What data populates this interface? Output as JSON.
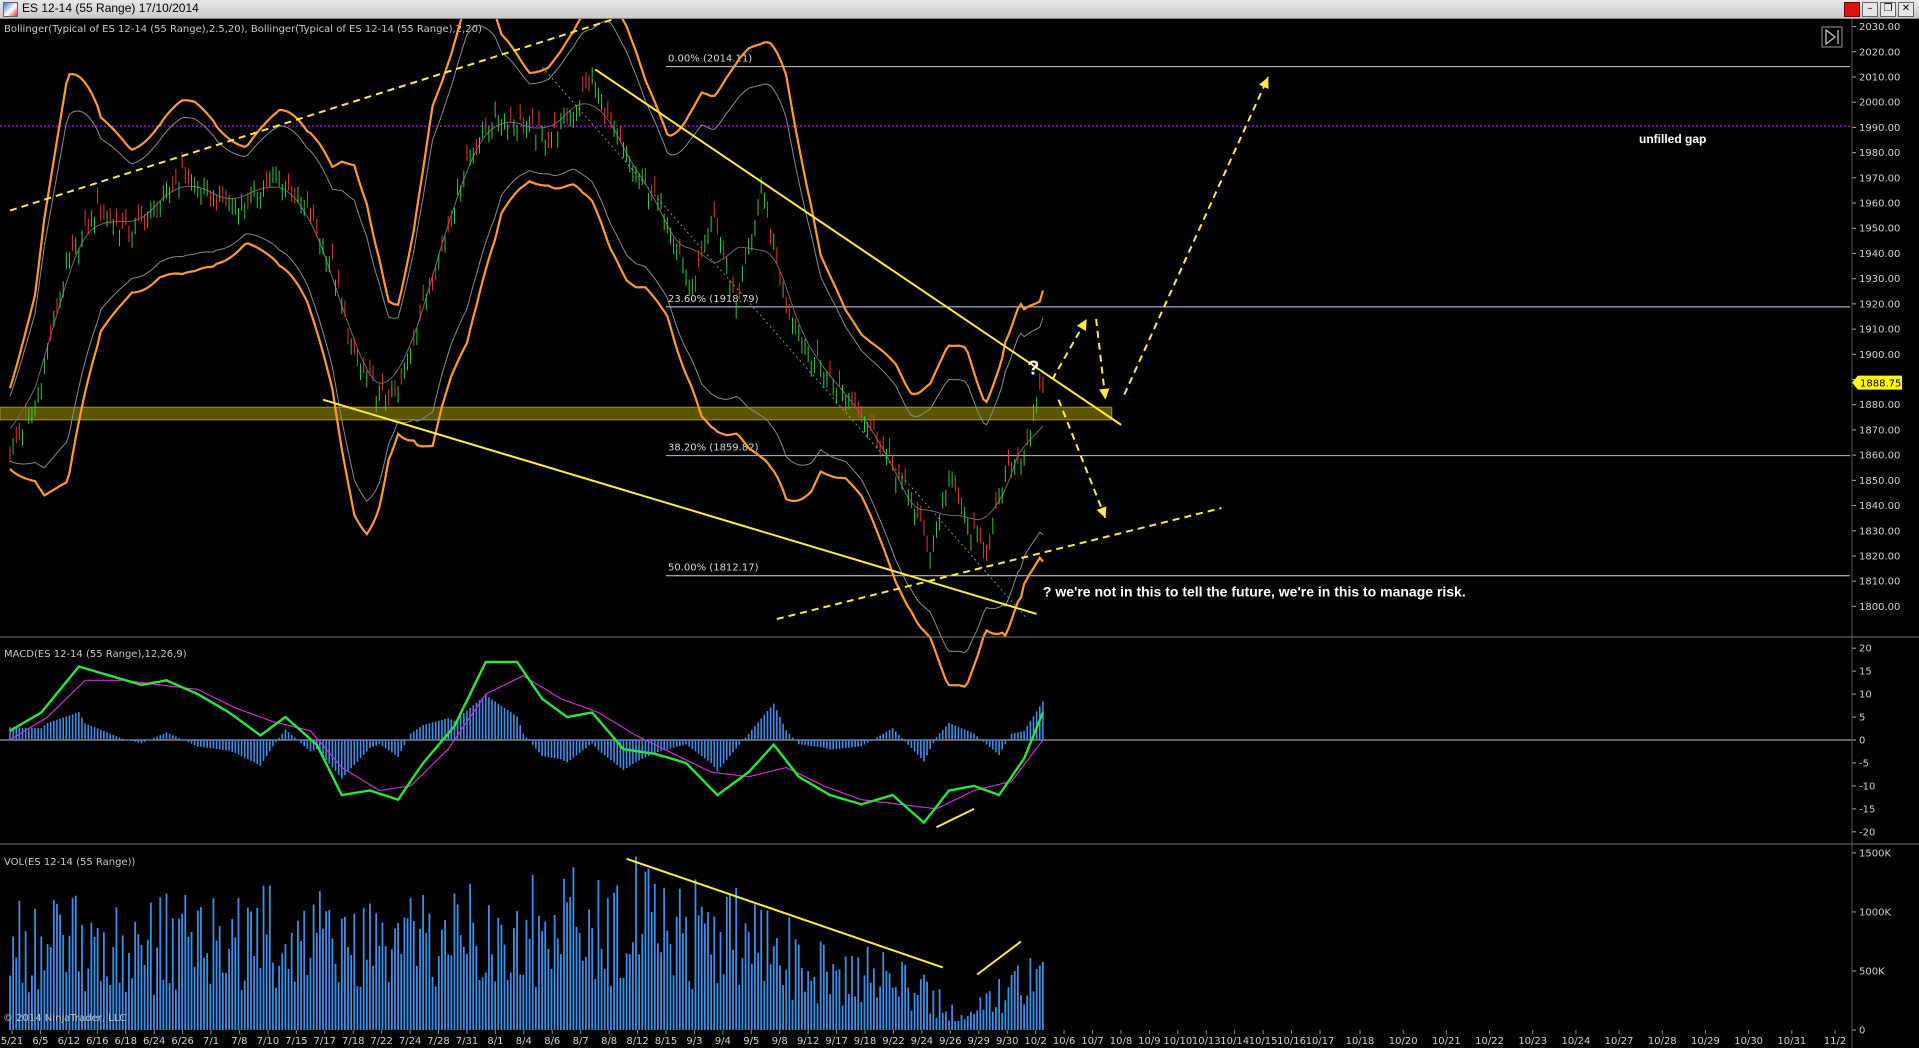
{
  "window": {
    "title": "ES 12-14 (55 Range)  17/10/2014",
    "close_glyph": "✕",
    "restore_glyph": "❐",
    "minimize_glyph": "–",
    "red_glyph": ""
  },
  "colors": {
    "background": "#000000",
    "bollinger_outer": "#ff9a2e",
    "bollinger_inner": "#8a8a8a",
    "candle_up": "#2ecc40",
    "candle_down": "#e8382e",
    "trendline": "#ffeb3b",
    "gap_line": "#a020f0",
    "zone": "#6b6400",
    "macd_line": "#27e83a",
    "signal_line": "#d02bd6",
    "histogram": "#3b8eea",
    "volume": "#3b8eea",
    "fib": "#a8d8ff",
    "price_marker": "#ffff00"
  },
  "chart_data": [
    {
      "type": "line",
      "panel": "price",
      "indicator_label": "Bollinger(Typical of ES 12-14 (55 Range),2.5,20), Bollinger(Typical of ES 12-14 (55 Range),2,20)",
      "y_ticks": [
        "1800.00",
        "1810.00",
        "1820.00",
        "1830.00",
        "1840.00",
        "1850.00",
        "1860.00",
        "1870.00",
        "1880.00",
        "1890.00",
        "1900.00",
        "1910.00",
        "1920.00",
        "1930.00",
        "1940.00",
        "1950.00",
        "1960.00",
        "1970.00",
        "1980.00",
        "1990.00",
        "2000.00",
        "2010.00",
        "2020.00",
        "2030.00"
      ],
      "y_tick_values": [
        1800,
        1810,
        1820,
        1830,
        1840,
        1850,
        1860,
        1870,
        1880,
        1890,
        1900,
        1910,
        1920,
        1930,
        1940,
        1950,
        1960,
        1970,
        1980,
        1990,
        2000,
        2010,
        2020,
        2030
      ],
      "ylim": [
        1795,
        2033
      ],
      "last_price": {
        "value": 1888.75,
        "label": "1888.75"
      },
      "fib_levels": [
        {
          "label": "0.00% (2014.11)",
          "value": 2014.11
        },
        {
          "label": "23.60% (1918.79)",
          "value": 1918.79
        },
        {
          "label": "38.20% (1859.82)",
          "value": 1859.82
        },
        {
          "label": "50.00% (1812.17)",
          "value": 1812.17
        }
      ],
      "unfilled_gap": {
        "label": "unfilled gap",
        "value": 1990.5
      },
      "support_zone": {
        "low": 1874,
        "high": 1879
      },
      "annotations": [
        {
          "text": "?",
          "bar": 325,
          "value": 1892
        },
        {
          "text": "?  we're not in this to tell the future, we're in this to manage risk.",
          "bar": 330,
          "value": 1804
        }
      ],
      "close_series": [
        {
          "bar": 0,
          "value": 1861
        },
        {
          "bar": 8,
          "value": 1880
        },
        {
          "bar": 18,
          "value": 1935
        },
        {
          "bar": 28,
          "value": 1958
        },
        {
          "bar": 38,
          "value": 1948
        },
        {
          "bar": 48,
          "value": 1960
        },
        {
          "bar": 55,
          "value": 1972
        },
        {
          "bar": 65,
          "value": 1962
        },
        {
          "bar": 75,
          "value": 1960
        },
        {
          "bar": 85,
          "value": 1972
        },
        {
          "bar": 95,
          "value": 1957
        },
        {
          "bar": 103,
          "value": 1936
        },
        {
          "bar": 110,
          "value": 1898
        },
        {
          "bar": 118,
          "value": 1884
        },
        {
          "bar": 124,
          "value": 1884
        },
        {
          "bar": 130,
          "value": 1912
        },
        {
          "bar": 138,
          "value": 1942
        },
        {
          "bar": 146,
          "value": 1978
        },
        {
          "bar": 155,
          "value": 1995
        },
        {
          "bar": 163,
          "value": 1992
        },
        {
          "bar": 172,
          "value": 1986
        },
        {
          "bar": 180,
          "value": 1997
        },
        {
          "bar": 186,
          "value": 2010
        },
        {
          "bar": 192,
          "value": 1990
        },
        {
          "bar": 200,
          "value": 1972
        },
        {
          "bar": 210,
          "value": 1956
        },
        {
          "bar": 218,
          "value": 1925
        },
        {
          "bar": 225,
          "value": 1955
        },
        {
          "bar": 232,
          "value": 1920
        },
        {
          "bar": 240,
          "value": 1965
        },
        {
          "bar": 248,
          "value": 1920
        },
        {
          "bar": 256,
          "value": 1900
        },
        {
          "bar": 264,
          "value": 1888
        },
        {
          "bar": 272,
          "value": 1878
        },
        {
          "bar": 280,
          "value": 1860
        },
        {
          "bar": 288,
          "value": 1842
        },
        {
          "bar": 294,
          "value": 1822
        },
        {
          "bar": 300,
          "value": 1852
        },
        {
          "bar": 306,
          "value": 1832
        },
        {
          "bar": 312,
          "value": 1822
        },
        {
          "bar": 318,
          "value": 1852
        },
        {
          "bar": 324,
          "value": 1862
        },
        {
          "bar": 330,
          "value": 1888
        }
      ],
      "trendlines": [
        {
          "style": "dashed",
          "from": {
            "bar": 0,
            "value": 1957
          },
          "to": {
            "bar": 193,
            "value": 2033
          }
        },
        {
          "style": "solid",
          "from": {
            "bar": 100,
            "value": 1882
          },
          "to": {
            "bar": 328,
            "value": 1797
          }
        },
        {
          "style": "solid",
          "from": {
            "bar": 187,
            "value": 2013
          },
          "to": {
            "bar": 355,
            "value": 1872
          }
        },
        {
          "style": "dashed",
          "from": {
            "bar": 245,
            "value": 1795
          },
          "to": {
            "bar": 387,
            "value": 1839
          }
        },
        {
          "style": "dashed-arrow",
          "from": {
            "bar": 333,
            "value": 1890
          },
          "to": {
            "bar": 344,
            "value": 1914
          }
        },
        {
          "style": "dashed-arrow",
          "from": {
            "bar": 347,
            "value": 1914
          },
          "to": {
            "bar": 350,
            "value": 1882
          }
        },
        {
          "style": "dashed-arrow",
          "from": {
            "bar": 356,
            "value": 1884
          },
          "to": {
            "bar": 402,
            "value": 2010
          }
        },
        {
          "style": "dashed-arrow",
          "from": {
            "bar": 335,
            "value": 1882
          },
          "to": {
            "bar": 350,
            "value": 1835
          }
        }
      ],
      "x_tick_labels": [
        "5/21",
        "6/5",
        "6/12",
        "6/16",
        "6/18",
        "6/24",
        "6/26",
        "7/1",
        "7/8",
        "7/10",
        "7/15",
        "7/17",
        "7/18",
        "7/22",
        "7/24",
        "7/28",
        "7/31",
        "8/1",
        "8/4",
        "8/6",
        "8/7",
        "8/8",
        "8/12",
        "8/15",
        "9/3",
        "9/4",
        "9/5",
        "9/8",
        "9/12",
        "9/17",
        "9/18",
        "9/22",
        "9/24",
        "9/26",
        "9/29",
        "9/30",
        "10/2",
        "10/6",
        "10/7",
        "10/8",
        "10/9",
        "10/10",
        "10/13",
        "10/14",
        "10/15",
        "10/16",
        "10/17",
        "10/18",
        "10/20",
        "10/21",
        "10/22",
        "10/23",
        "10/24",
        "10/27",
        "10/28",
        "10/29",
        "10/30",
        "10/31",
        "11/2"
      ]
    },
    {
      "type": "line",
      "panel": "macd",
      "indicator_label": "MACD(ES 12-14 (55 Range),12,26,9)",
      "y_ticks": [
        "-20",
        "-15",
        "-10",
        "-5",
        "0",
        "5",
        "10",
        "15",
        "20"
      ],
      "y_tick_values": [
        -20,
        -15,
        -10,
        -5,
        0,
        5,
        10,
        15,
        20
      ],
      "ylim": [
        -22,
        22
      ],
      "series": [
        {
          "role": "macd",
          "points": [
            {
              "bar": 0,
              "value": 2
            },
            {
              "bar": 10,
              "value": 6
            },
            {
              "bar": 22,
              "value": 16
            },
            {
              "bar": 32,
              "value": 14
            },
            {
              "bar": 42,
              "value": 12
            },
            {
              "bar": 50,
              "value": 13
            },
            {
              "bar": 60,
              "value": 10
            },
            {
              "bar": 70,
              "value": 6
            },
            {
              "bar": 80,
              "value": 1
            },
            {
              "bar": 88,
              "value": 5
            },
            {
              "bar": 98,
              "value": -1
            },
            {
              "bar": 106,
              "value": -12
            },
            {
              "bar": 115,
              "value": -11
            },
            {
              "bar": 124,
              "value": -13
            },
            {
              "bar": 132,
              "value": -5
            },
            {
              "bar": 142,
              "value": 3
            },
            {
              "bar": 152,
              "value": 17
            },
            {
              "bar": 162,
              "value": 17
            },
            {
              "bar": 170,
              "value": 9
            },
            {
              "bar": 178,
              "value": 5
            },
            {
              "bar": 186,
              "value": 6
            },
            {
              "bar": 196,
              "value": -2
            },
            {
              "bar": 206,
              "value": -3
            },
            {
              "bar": 216,
              "value": -5
            },
            {
              "bar": 226,
              "value": -12
            },
            {
              "bar": 236,
              "value": -7
            },
            {
              "bar": 244,
              "value": -1
            },
            {
              "bar": 252,
              "value": -8
            },
            {
              "bar": 262,
              "value": -12
            },
            {
              "bar": 272,
              "value": -14
            },
            {
              "bar": 282,
              "value": -12
            },
            {
              "bar": 292,
              "value": -18
            },
            {
              "bar": 300,
              "value": -11
            },
            {
              "bar": 308,
              "value": -10
            },
            {
              "bar": 316,
              "value": -12
            },
            {
              "bar": 324,
              "value": -4
            },
            {
              "bar": 330,
              "value": 6
            }
          ]
        },
        {
          "role": "signal",
          "points": [
            {
              "bar": 0,
              "value": 0
            },
            {
              "bar": 12,
              "value": 5
            },
            {
              "bar": 24,
              "value": 13
            },
            {
              "bar": 36,
              "value": 13
            },
            {
              "bar": 48,
              "value": 12
            },
            {
              "bar": 60,
              "value": 11
            },
            {
              "bar": 72,
              "value": 7
            },
            {
              "bar": 84,
              "value": 4
            },
            {
              "bar": 96,
              "value": 2
            },
            {
              "bar": 106,
              "value": -6
            },
            {
              "bar": 118,
              "value": -11
            },
            {
              "bar": 128,
              "value": -10
            },
            {
              "bar": 140,
              "value": -2
            },
            {
              "bar": 152,
              "value": 10
            },
            {
              "bar": 164,
              "value": 14
            },
            {
              "bar": 176,
              "value": 9
            },
            {
              "bar": 188,
              "value": 6
            },
            {
              "bar": 200,
              "value": 1
            },
            {
              "bar": 212,
              "value": -3
            },
            {
              "bar": 224,
              "value": -7
            },
            {
              "bar": 236,
              "value": -8
            },
            {
              "bar": 248,
              "value": -6
            },
            {
              "bar": 260,
              "value": -10
            },
            {
              "bar": 272,
              "value": -13
            },
            {
              "bar": 284,
              "value": -14
            },
            {
              "bar": 296,
              "value": -15
            },
            {
              "bar": 308,
              "value": -11
            },
            {
              "bar": 320,
              "value": -9
            },
            {
              "bar": 330,
              "value": 0
            }
          ]
        }
      ],
      "trendlines": [
        {
          "style": "solid",
          "from": {
            "bar": 296,
            "value": -19
          },
          "to": {
            "bar": 308,
            "value": -15
          }
        }
      ]
    },
    {
      "type": "bar",
      "panel": "volume",
      "indicator_label": "VOL(ES 12-14 (55 Range))",
      "y_ticks": [
        "0",
        "500K",
        "1000K",
        "1500K"
      ],
      "y_tick_values": [
        0,
        500000,
        1000000,
        1500000
      ],
      "ylim": [
        0,
        1550000
      ],
      "profile": [
        {
          "bar": 0,
          "value": 850000
        },
        {
          "bar": 40,
          "value": 820000
        },
        {
          "bar": 80,
          "value": 900000
        },
        {
          "bar": 120,
          "value": 780000
        },
        {
          "bar": 150,
          "value": 900000
        },
        {
          "bar": 180,
          "value": 1000000
        },
        {
          "bar": 200,
          "value": 1050000
        },
        {
          "bar": 230,
          "value": 880000
        },
        {
          "bar": 260,
          "value": 600000
        },
        {
          "bar": 285,
          "value": 470000
        },
        {
          "bar": 298,
          "value": 250000
        },
        {
          "bar": 305,
          "value": 100000
        },
        {
          "bar": 315,
          "value": 380000
        },
        {
          "bar": 330,
          "value": 600000
        }
      ],
      "trendlines": [
        {
          "style": "solid",
          "from": {
            "bar": 197,
            "value": 1450000
          },
          "to": {
            "bar": 298,
            "value": 530000
          }
        },
        {
          "style": "solid",
          "from": {
            "bar": 309,
            "value": 470000
          },
          "to": {
            "bar": 323,
            "value": 750000
          }
        }
      ]
    }
  ],
  "footer": {
    "copyright": "© 2014 NinjaTrader, LLC"
  }
}
